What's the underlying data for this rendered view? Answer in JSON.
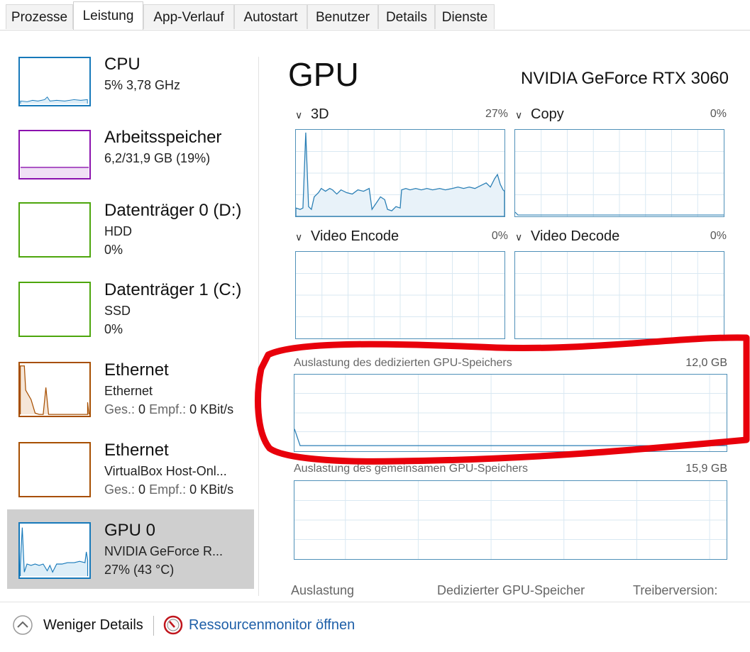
{
  "tabs": [
    "Prozesse",
    "Leistung",
    "App-Verlauf",
    "Autostart",
    "Benutzer",
    "Details",
    "Dienste"
  ],
  "sidebar": {
    "items": [
      {
        "title": "CPU",
        "line1": "5% 3,78 GHz",
        "line2": ""
      },
      {
        "title": "Arbeitsspeicher",
        "line1": "6,2/31,9 GB (19%)",
        "line2": ""
      },
      {
        "title": "Datenträger 0 (D:)",
        "line1": "HDD",
        "line2": "0%"
      },
      {
        "title": "Datenträger 1 (C:)",
        "line1": "SSD",
        "line2": "0%"
      },
      {
        "title": "Ethernet",
        "line1": "Ethernet",
        "send_label": "Ges.:",
        "send_value": "0",
        "recv_label": "Empf.:",
        "recv_value": "0 KBit/s"
      },
      {
        "title": "Ethernet",
        "line1": "VirtualBox Host-Onl...",
        "send_label": "Ges.:",
        "send_value": "0",
        "recv_label": "Empf.:",
        "recv_value": "0 KBit/s"
      },
      {
        "title": "GPU 0",
        "line1": "NVIDIA GeForce R...",
        "line2": "27% (43 °C)"
      }
    ]
  },
  "main": {
    "title": "GPU",
    "model": "NVIDIA GeForce RTX 3060",
    "graphs": [
      {
        "label": "3D",
        "percent": "27%"
      },
      {
        "label": "Copy",
        "percent": "0%"
      },
      {
        "label": "Video Encode",
        "percent": "0%"
      },
      {
        "label": "Video Decode",
        "percent": "0%"
      }
    ],
    "dedicated_memory": {
      "label": "Auslastung des dedizierten GPU-Speichers",
      "value": "12,0 GB"
    },
    "shared_memory": {
      "label": "Auslastung des gemeinsamen GPU-Speichers",
      "value": "15,9 GB"
    },
    "stats": {
      "utilization": "Auslastung",
      "dedicated": "Dedizierter GPU-Speicher",
      "driver": "Treiberversion:"
    }
  },
  "footer": {
    "fewer_details": "Weniger Details",
    "resource_monitor": "Ressourcenmonitor öffnen"
  },
  "colors": {
    "cpu": "#1779ba",
    "memory": "#8b12ae",
    "disk": "#4da60c",
    "ethernet": "#a74f01",
    "gpu": "#1779ba",
    "graph_border": "#4f90b8",
    "grid": "#d9e8f2",
    "highlight": "#e8000b",
    "link": "#1e5fa8"
  }
}
